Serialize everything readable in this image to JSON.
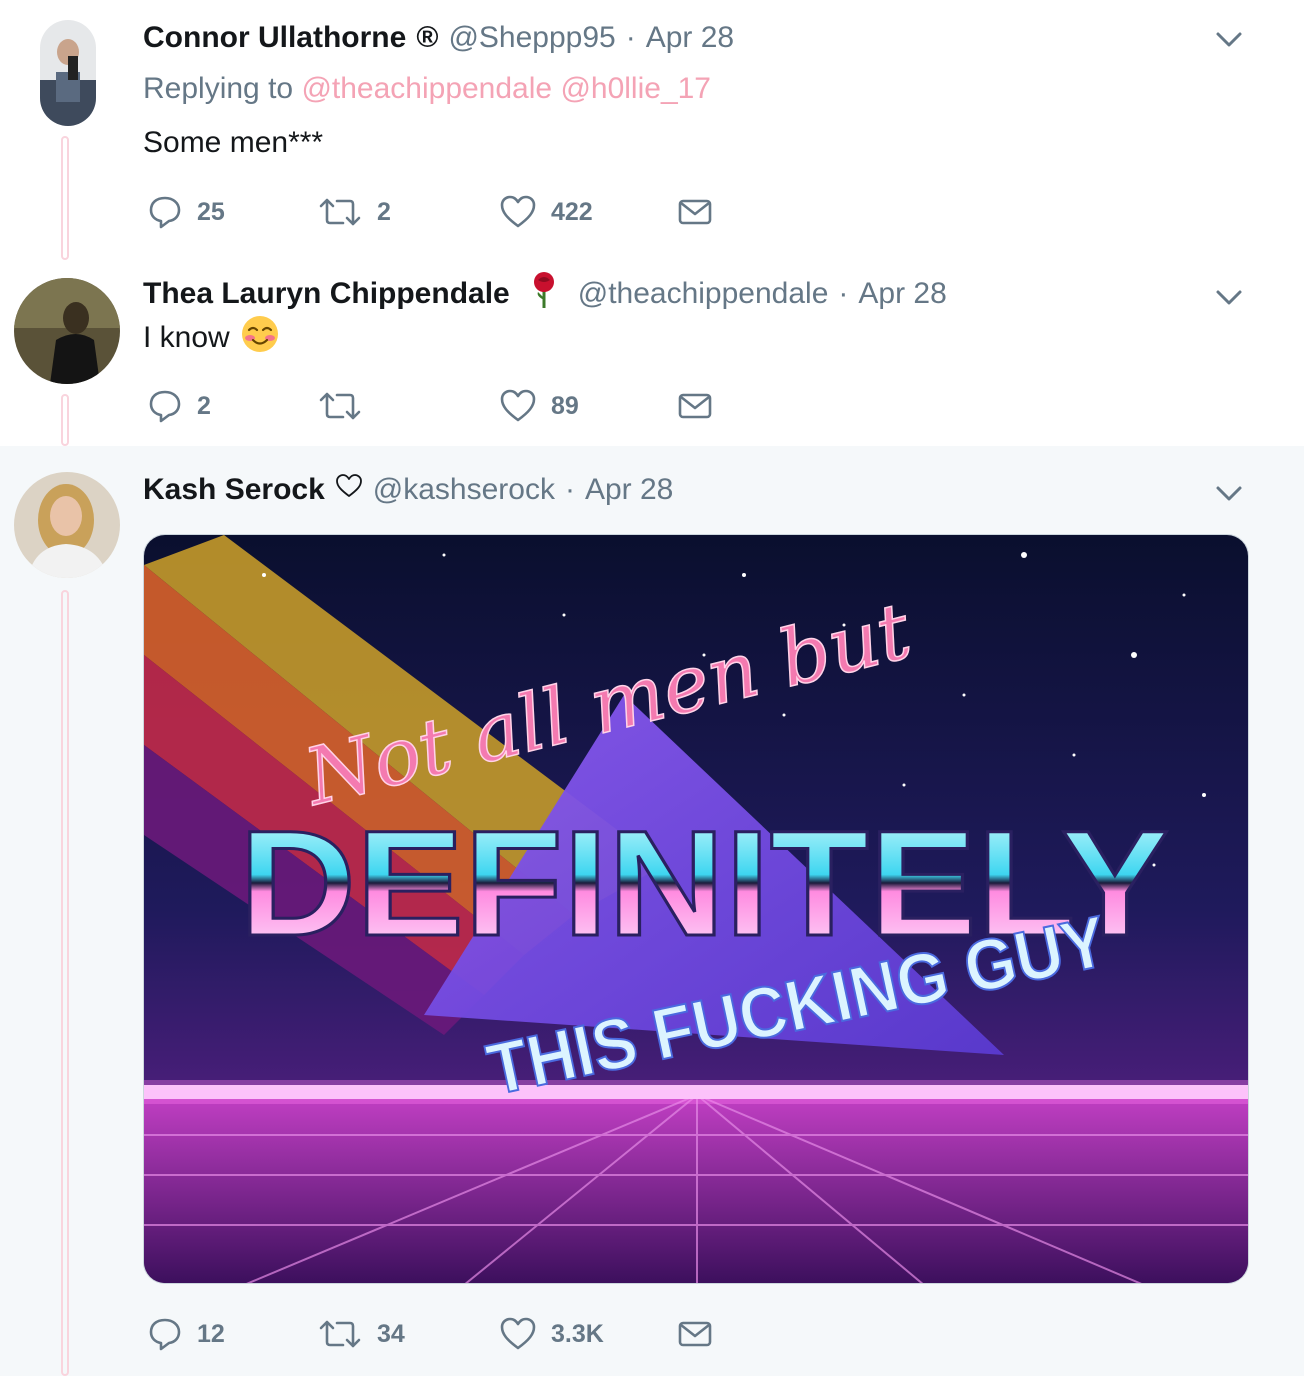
{
  "tweets": [
    {
      "name": "Connor Ullathorne",
      "name_badge": "®",
      "handle": "@Sheppp95",
      "separator": "·",
      "date": "Apr 28",
      "replying_label": "Replying to",
      "replying_to": [
        "@theachippendale",
        "@h0llie_17"
      ],
      "text": "Some men***",
      "stats": {
        "replies": "25",
        "retweets": "2",
        "likes": "422"
      }
    },
    {
      "name": "Thea Lauryn Chippendale",
      "name_emoji": "rose-emoji",
      "handle": "@theachippendale",
      "separator": "·",
      "date": "Apr 28",
      "text": "I know",
      "text_emoji": "smiling-face-emoji",
      "stats": {
        "replies": "2",
        "retweets": "",
        "likes": "89"
      }
    },
    {
      "name": "Kash Serock",
      "name_icon": "heart-outline-icon",
      "handle": "@kashserock",
      "separator": "·",
      "date": "Apr 28",
      "media": {
        "line1": "Not all men but",
        "line2": "DEFINITELY",
        "line3": "THIS FUCKING GUY"
      },
      "stats": {
        "replies": "12",
        "retweets": "34",
        "likes": "3.3K"
      }
    }
  ],
  "colors": {
    "text": "#14171a",
    "secondary": "#657786",
    "link": "#f4a3b5",
    "thread_line": "#f9d4dd",
    "highlight_bg": "#f5f8fa"
  }
}
